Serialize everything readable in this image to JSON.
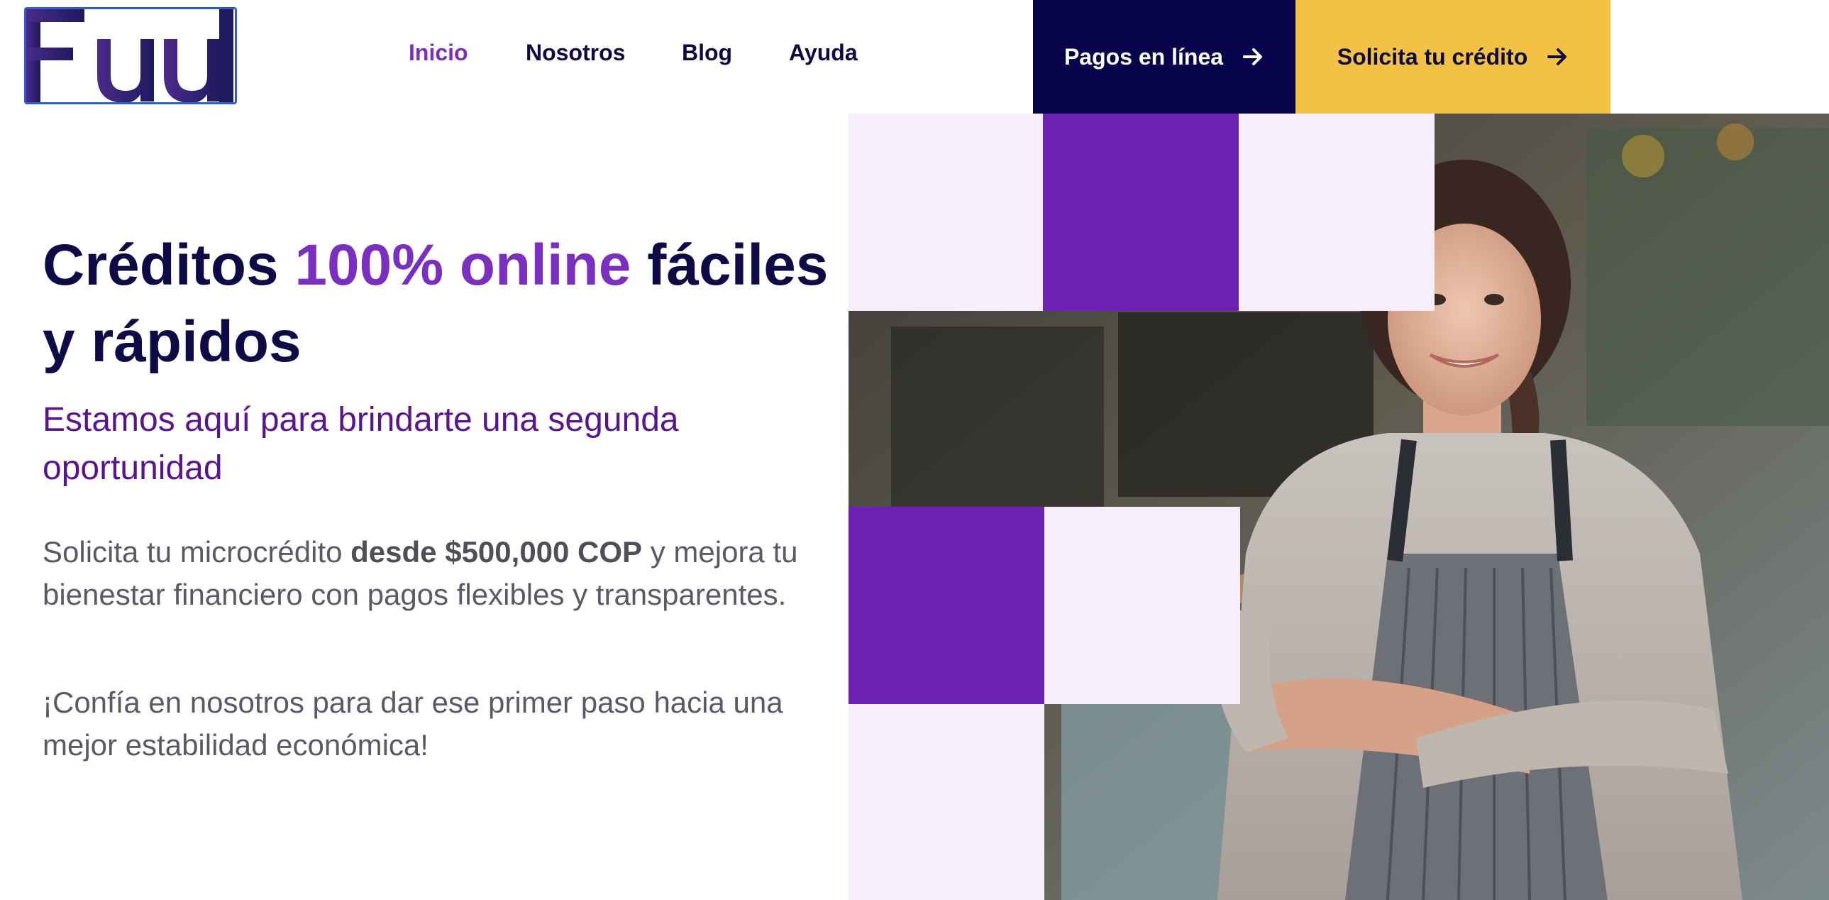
{
  "brand": {
    "logo_text": "Fuul"
  },
  "nav": {
    "items": [
      {
        "label": "Inicio",
        "active": true
      },
      {
        "label": "Nosotros",
        "active": false
      },
      {
        "label": "Blog",
        "active": false
      },
      {
        "label": "Ayuda",
        "active": false
      }
    ]
  },
  "actions": {
    "pay_label": "Pagos en línea",
    "credit_label": "Solicita tu crédito",
    "arrow_icon": "arrow-right-icon"
  },
  "hero": {
    "title_part1": "Créditos ",
    "title_accent": "100% online",
    "title_part2": " fáciles y rápidos",
    "subtitle": "Estamos aquí para brindarte una segunda oportunidad",
    "p1_part1": "Solicita tu microcrédito ",
    "p1_bold": "desde $500,000 COP",
    "p1_part2": " y mejora tu bienestar financiero con pagos flexibles y transparentes.",
    "p2": "¡Confía en nosotros para dar ese primer paso hacia una mejor estabilidad económica!"
  },
  "colors": {
    "navy": "#06034a",
    "purple": "#7b2fc0",
    "deep_purple": "#6e1fb4",
    "yellow": "#f3c244",
    "light_lavender": "#f7eefc",
    "body_text": "#5a5a66"
  }
}
